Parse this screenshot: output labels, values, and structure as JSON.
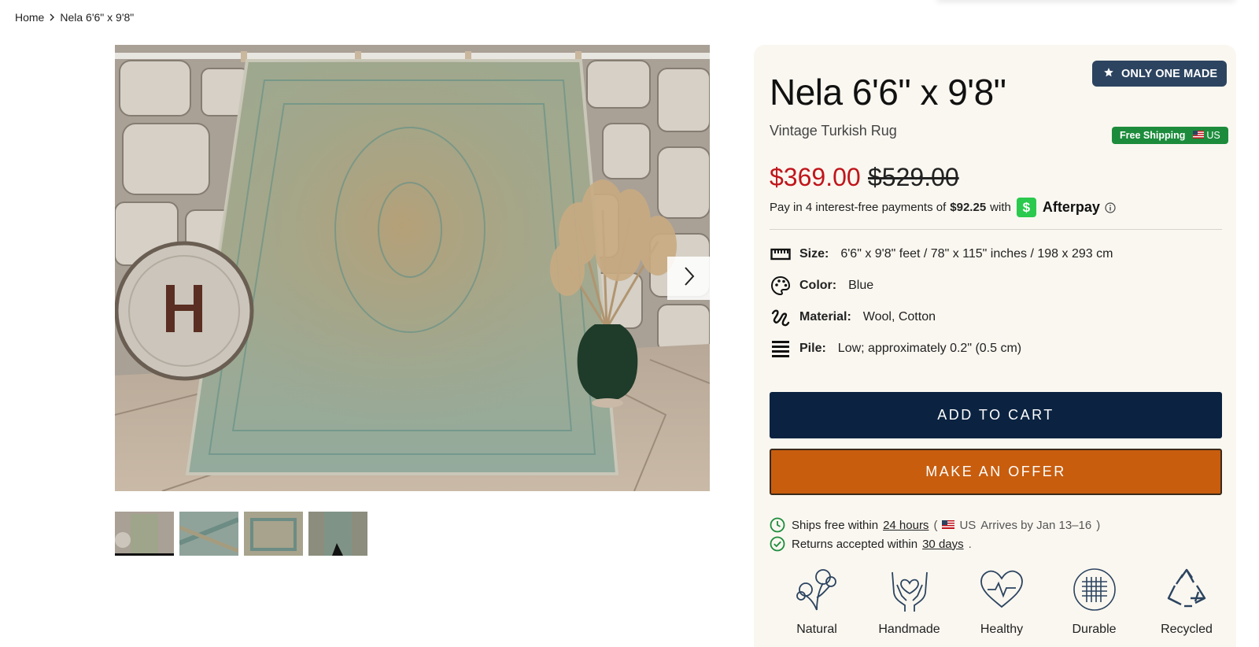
{
  "breadcrumb": {
    "home": "Home",
    "current": "Nela 6'6\" x 9'8\""
  },
  "gallery": {
    "main_image_alt": "Vintage Turkish rug hanging on stone wall",
    "thumbnails": [
      "thumb-1",
      "thumb-2",
      "thumb-3",
      "thumb-4"
    ],
    "active_thumb": 0
  },
  "product": {
    "badge": "ONLY ONE MADE",
    "title": "Nela 6'6\" x 9'8\"",
    "subtitle": "Vintage Turkish Rug",
    "shipping_badge": "Free Shipping",
    "shipping_region": "US",
    "price": "$369.00",
    "compare_price": "$529.00",
    "afterpay": {
      "text": "Pay in 4 interest-free payments of",
      "amount": "$92.25",
      "with": "with",
      "logo_glyph": "$",
      "brand": "Afterpay"
    },
    "specs": {
      "size": {
        "label": "Size:",
        "value": "6'6\" x 9'8\" feet / 78\" x 115\" inches / 198 x 293 cm"
      },
      "color": {
        "label": "Color:",
        "value": "Blue"
      },
      "material": {
        "label": "Material:",
        "value": "Wool, Cotton"
      },
      "pile": {
        "label": "Pile:",
        "value": "Low; approximately 0.2\" (0.5 cm)"
      }
    },
    "buttons": {
      "add_to_cart": "ADD TO CART",
      "make_offer": "MAKE AN OFFER"
    },
    "shipping": {
      "ships_text": "Ships free within",
      "ships_link": "24 hours",
      "open_paren": "(",
      "region": "US",
      "arrives": "Arrives by Jan 13–16",
      "close_paren": ")",
      "returns_text": "Returns accepted within",
      "returns_link": "30 days",
      "period": "."
    },
    "features": [
      "Natural",
      "Handmade",
      "Healthy",
      "Durable",
      "Recycled"
    ]
  },
  "colors": {
    "price_red": "#c0151b",
    "navy_button": "#0b2341",
    "offer_orange": "#c85d0e",
    "badge_navy": "#2c4460",
    "ship_green": "#1c8c3c",
    "afterpay_green": "#2bc94d",
    "panel_bg": "#faf7f0"
  }
}
